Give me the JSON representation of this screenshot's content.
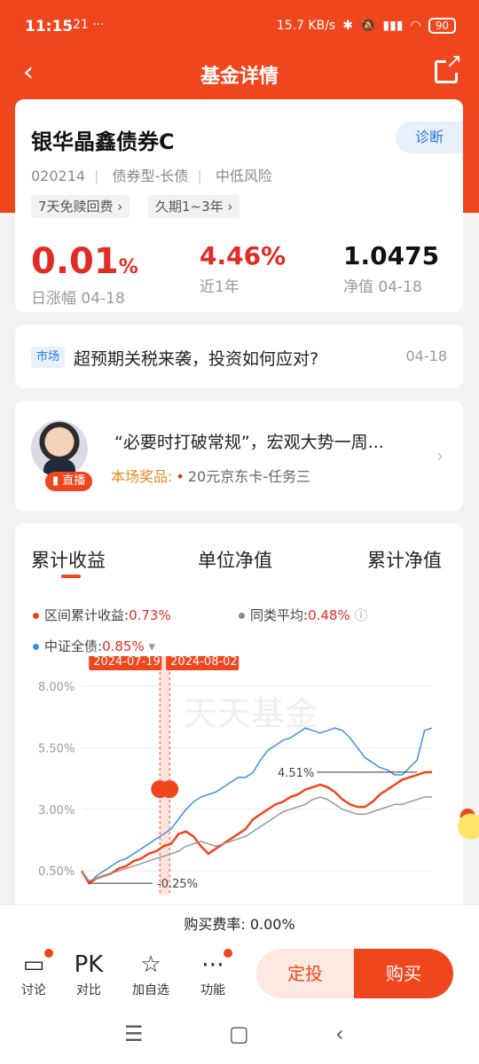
{
  "status_bar": {
    "time": "11:15",
    "left_icons": "21 ···",
    "net_speed": "15.7 KB/s",
    "battery": "90"
  },
  "nav": {
    "title": "基金详情",
    "back_icon": "back-arrow-icon",
    "share_icon": "share-icon"
  },
  "fund": {
    "name": "银华晶鑫债券C",
    "code": "020214",
    "type": "债券型-长债",
    "risk": "中低风险",
    "diagnose_label": "诊断",
    "tags": [
      "7天免赎回费 ›",
      "久期1~3年 ›"
    ],
    "daily_change": {
      "value": "0.01",
      "unit": "%",
      "label": "日涨幅 04-18"
    },
    "year_return": {
      "value": "4.46%",
      "label": "近1年"
    },
    "nav_value": {
      "value": "1.0475",
      "label": "净值 04-18"
    }
  },
  "news": {
    "tag": "市场",
    "text": "超预期关税来袭，投资如何应对?",
    "date": "04-18"
  },
  "live": {
    "badge": "直播",
    "title": "“必要时打破常规”，宏观大势一周...",
    "prize_label": "本场奖品:",
    "prize_value": "20元京东卡-任务三"
  },
  "chart_tabs": [
    "累计收益",
    "单位净值",
    "累计净值"
  ],
  "legend": {
    "fund": {
      "label": "区间累计收益:",
      "value": "0.73%",
      "color": "#f0461e"
    },
    "peer": {
      "label": "同类平均:",
      "value": "0.48%",
      "color": "#8a8a8a"
    },
    "index": {
      "label": "中证全债:",
      "value": "0.85%",
      "color": "#3b8fe0"
    }
  },
  "chart_data": {
    "type": "line",
    "yticks": [
      "8.00%",
      "5.50%",
      "3.00%",
      "0.50%"
    ],
    "ylim": [
      -0.5,
      8.5
    ],
    "markers": [
      "2024-07-19",
      "2024-08-02"
    ],
    "annotations": {
      "max": "4.51%",
      "min": "-0.25%"
    },
    "watermark": "天天基金",
    "series": [
      {
        "name": "",
        "color": "#3b8fe0",
        "values": [
          0.5,
          0.0,
          0.3,
          0.5,
          0.7,
          0.9,
          1.0,
          1.2,
          1.4,
          1.6,
          1.8,
          2.0,
          2.2,
          2.6,
          3.0,
          3.3,
          3.5,
          3.6,
          3.7,
          3.9,
          4.1,
          4.3,
          4.3,
          4.5,
          5.0,
          5.4,
          5.6,
          5.8,
          5.9,
          6.1,
          6.3,
          6.2,
          6.1,
          6.2,
          6.3,
          6.2,
          5.9,
          5.5,
          5.1,
          4.9,
          4.7,
          4.6,
          4.4,
          4.4,
          4.7,
          5.0,
          6.2,
          6.3
        ]
      },
      {
        "name": "",
        "color": "#f0461e",
        "values": [
          0.5,
          0.0,
          0.2,
          0.3,
          0.4,
          0.6,
          0.7,
          0.9,
          1.0,
          1.2,
          1.3,
          1.5,
          1.6,
          2.0,
          2.1,
          1.9,
          1.5,
          1.2,
          1.4,
          1.6,
          1.8,
          2.0,
          2.2,
          2.6,
          2.8,
          3.0,
          3.2,
          3.3,
          3.5,
          3.6,
          3.8,
          3.9,
          4.0,
          3.9,
          3.7,
          3.4,
          3.2,
          3.1,
          3.1,
          3.3,
          3.6,
          3.8,
          4.0,
          4.2,
          4.3,
          4.4,
          4.5,
          4.51
        ]
      },
      {
        "name": "",
        "color": "#9a9a9a",
        "values": [
          0.5,
          0.1,
          0.2,
          0.3,
          0.4,
          0.5,
          0.6,
          0.7,
          0.8,
          0.9,
          1.0,
          1.1,
          1.2,
          1.3,
          1.5,
          1.6,
          1.7,
          1.6,
          1.5,
          1.6,
          1.7,
          1.8,
          1.9,
          2.1,
          2.3,
          2.5,
          2.7,
          2.9,
          3.0,
          3.1,
          3.2,
          3.4,
          3.5,
          3.4,
          3.2,
          3.0,
          2.9,
          2.8,
          2.8,
          2.9,
          3.0,
          3.1,
          3.2,
          3.2,
          3.3,
          3.4,
          3.5,
          3.5
        ]
      }
    ]
  },
  "fee": {
    "label": "购买费率:",
    "value": "0.00%"
  },
  "actions": [
    {
      "label": "讨论",
      "icon": "chat-icon",
      "glyph": "💬"
    },
    {
      "label": "对比",
      "icon": "compare-icon",
      "glyph": "PK"
    },
    {
      "label": "加自选",
      "icon": "star-icon",
      "glyph": "☆"
    },
    {
      "label": "功能",
      "icon": "more-icon",
      "glyph": "⋯"
    }
  ],
  "buttons": {
    "regular_invest": "定投",
    "buy": "购买"
  }
}
